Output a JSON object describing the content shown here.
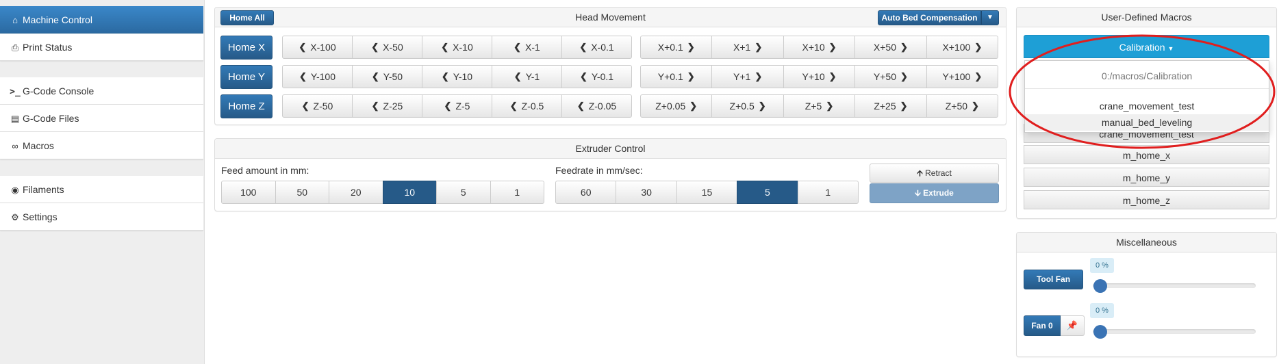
{
  "sidebar": {
    "groups": [
      [
        {
          "label": "Machine Control",
          "icon": "home-icon",
          "active": true
        },
        {
          "label": "Print Status",
          "icon": "print-icon"
        }
      ],
      [
        {
          "label": "G-Code Console",
          "icon": "console-icon"
        },
        {
          "label": "G-Code Files",
          "icon": "hdd-icon"
        },
        {
          "label": "Macros",
          "icon": "link-icon"
        }
      ],
      [
        {
          "label": "Filaments",
          "icon": "globe-icon"
        },
        {
          "label": "Settings",
          "icon": "gear-icon"
        }
      ]
    ]
  },
  "head_movement": {
    "title": "Head Movement",
    "home_all": "Home All",
    "auto_bed": "Auto Bed Compensation",
    "home_x": "Home X",
    "home_y": "Home Y",
    "home_z": "Home Z",
    "x_neg": [
      "X-100",
      "X-50",
      "X-10",
      "X-1",
      "X-0.1"
    ],
    "x_pos": [
      "X+0.1",
      "X+1",
      "X+10",
      "X+50",
      "X+100"
    ],
    "y_neg": [
      "Y-100",
      "Y-50",
      "Y-10",
      "Y-1",
      "Y-0.1"
    ],
    "y_pos": [
      "Y+0.1",
      "Y+1",
      "Y+10",
      "Y+50",
      "Y+100"
    ],
    "z_neg": [
      "Z-50",
      "Z-25",
      "Z-5",
      "Z-0.5",
      "Z-0.05"
    ],
    "z_pos": [
      "Z+0.05",
      "Z+0.5",
      "Z+5",
      "Z+25",
      "Z+50"
    ]
  },
  "extruder": {
    "title": "Extruder Control",
    "feed_label": "Feed amount in mm:",
    "feed_values": [
      "100",
      "50",
      "20",
      "10",
      "5",
      "1"
    ],
    "feed_selected": "10",
    "rate_label": "Feedrate in mm/sec:",
    "rate_values": [
      "60",
      "30",
      "15",
      "5",
      "1"
    ],
    "rate_selected": "5",
    "retract": "Retract",
    "extrude": "Extrude"
  },
  "macros": {
    "title": "User-Defined Macros",
    "dropdown_label": "Calibration",
    "dropdown_items": [
      "0:/macros/Calibration",
      "crane_movement_test",
      "manual_bed_leveling"
    ],
    "list_behind": [
      "crane_movement_test",
      "m_home_x",
      "m_home_y",
      "m_home_z"
    ]
  },
  "misc": {
    "title": "Miscellaneous",
    "tool_fan": "Tool Fan",
    "tool_fan_value": "0 %",
    "tool_fan_level": 0,
    "fan0": "Fan 0",
    "fan0_value": "0 %",
    "fan0_level": 0
  },
  "colors": {
    "primary": "#337ab7",
    "active_nav": "#3278b3",
    "annotation": "#e01e1e"
  }
}
